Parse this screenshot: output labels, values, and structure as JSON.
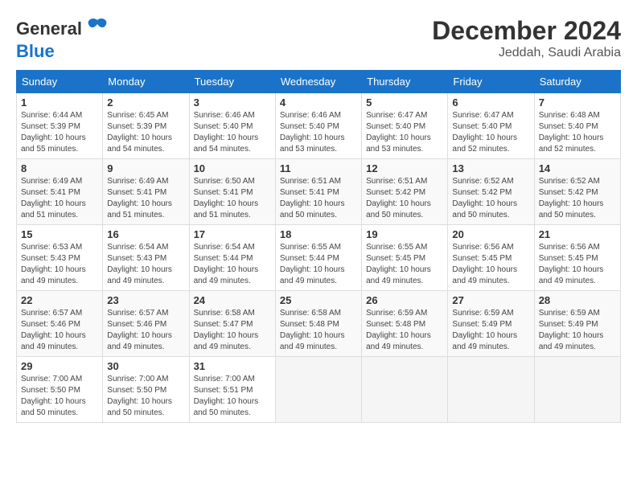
{
  "logo": {
    "line1": "General",
    "line2": "Blue"
  },
  "title": "December 2024",
  "subtitle": "Jeddah, Saudi Arabia",
  "weekdays": [
    "Sunday",
    "Monday",
    "Tuesday",
    "Wednesday",
    "Thursday",
    "Friday",
    "Saturday"
  ],
  "weeks": [
    [
      {
        "day": "1",
        "info": "Sunrise: 6:44 AM\nSunset: 5:39 PM\nDaylight: 10 hours\nand 55 minutes."
      },
      {
        "day": "2",
        "info": "Sunrise: 6:45 AM\nSunset: 5:39 PM\nDaylight: 10 hours\nand 54 minutes."
      },
      {
        "day": "3",
        "info": "Sunrise: 6:46 AM\nSunset: 5:40 PM\nDaylight: 10 hours\nand 54 minutes."
      },
      {
        "day": "4",
        "info": "Sunrise: 6:46 AM\nSunset: 5:40 PM\nDaylight: 10 hours\nand 53 minutes."
      },
      {
        "day": "5",
        "info": "Sunrise: 6:47 AM\nSunset: 5:40 PM\nDaylight: 10 hours\nand 53 minutes."
      },
      {
        "day": "6",
        "info": "Sunrise: 6:47 AM\nSunset: 5:40 PM\nDaylight: 10 hours\nand 52 minutes."
      },
      {
        "day": "7",
        "info": "Sunrise: 6:48 AM\nSunset: 5:40 PM\nDaylight: 10 hours\nand 52 minutes."
      }
    ],
    [
      {
        "day": "8",
        "info": "Sunrise: 6:49 AM\nSunset: 5:41 PM\nDaylight: 10 hours\nand 51 minutes."
      },
      {
        "day": "9",
        "info": "Sunrise: 6:49 AM\nSunset: 5:41 PM\nDaylight: 10 hours\nand 51 minutes."
      },
      {
        "day": "10",
        "info": "Sunrise: 6:50 AM\nSunset: 5:41 PM\nDaylight: 10 hours\nand 51 minutes."
      },
      {
        "day": "11",
        "info": "Sunrise: 6:51 AM\nSunset: 5:41 PM\nDaylight: 10 hours\nand 50 minutes."
      },
      {
        "day": "12",
        "info": "Sunrise: 6:51 AM\nSunset: 5:42 PM\nDaylight: 10 hours\nand 50 minutes."
      },
      {
        "day": "13",
        "info": "Sunrise: 6:52 AM\nSunset: 5:42 PM\nDaylight: 10 hours\nand 50 minutes."
      },
      {
        "day": "14",
        "info": "Sunrise: 6:52 AM\nSunset: 5:42 PM\nDaylight: 10 hours\nand 50 minutes."
      }
    ],
    [
      {
        "day": "15",
        "info": "Sunrise: 6:53 AM\nSunset: 5:43 PM\nDaylight: 10 hours\nand 49 minutes."
      },
      {
        "day": "16",
        "info": "Sunrise: 6:54 AM\nSunset: 5:43 PM\nDaylight: 10 hours\nand 49 minutes."
      },
      {
        "day": "17",
        "info": "Sunrise: 6:54 AM\nSunset: 5:44 PM\nDaylight: 10 hours\nand 49 minutes."
      },
      {
        "day": "18",
        "info": "Sunrise: 6:55 AM\nSunset: 5:44 PM\nDaylight: 10 hours\nand 49 minutes."
      },
      {
        "day": "19",
        "info": "Sunrise: 6:55 AM\nSunset: 5:45 PM\nDaylight: 10 hours\nand 49 minutes."
      },
      {
        "day": "20",
        "info": "Sunrise: 6:56 AM\nSunset: 5:45 PM\nDaylight: 10 hours\nand 49 minutes."
      },
      {
        "day": "21",
        "info": "Sunrise: 6:56 AM\nSunset: 5:45 PM\nDaylight: 10 hours\nand 49 minutes."
      }
    ],
    [
      {
        "day": "22",
        "info": "Sunrise: 6:57 AM\nSunset: 5:46 PM\nDaylight: 10 hours\nand 49 minutes."
      },
      {
        "day": "23",
        "info": "Sunrise: 6:57 AM\nSunset: 5:46 PM\nDaylight: 10 hours\nand 49 minutes."
      },
      {
        "day": "24",
        "info": "Sunrise: 6:58 AM\nSunset: 5:47 PM\nDaylight: 10 hours\nand 49 minutes."
      },
      {
        "day": "25",
        "info": "Sunrise: 6:58 AM\nSunset: 5:48 PM\nDaylight: 10 hours\nand 49 minutes."
      },
      {
        "day": "26",
        "info": "Sunrise: 6:59 AM\nSunset: 5:48 PM\nDaylight: 10 hours\nand 49 minutes."
      },
      {
        "day": "27",
        "info": "Sunrise: 6:59 AM\nSunset: 5:49 PM\nDaylight: 10 hours\nand 49 minutes."
      },
      {
        "day": "28",
        "info": "Sunrise: 6:59 AM\nSunset: 5:49 PM\nDaylight: 10 hours\nand 49 minutes."
      }
    ],
    [
      {
        "day": "29",
        "info": "Sunrise: 7:00 AM\nSunset: 5:50 PM\nDaylight: 10 hours\nand 50 minutes."
      },
      {
        "day": "30",
        "info": "Sunrise: 7:00 AM\nSunset: 5:50 PM\nDaylight: 10 hours\nand 50 minutes."
      },
      {
        "day": "31",
        "info": "Sunrise: 7:00 AM\nSunset: 5:51 PM\nDaylight: 10 hours\nand 50 minutes."
      },
      null,
      null,
      null,
      null
    ]
  ]
}
